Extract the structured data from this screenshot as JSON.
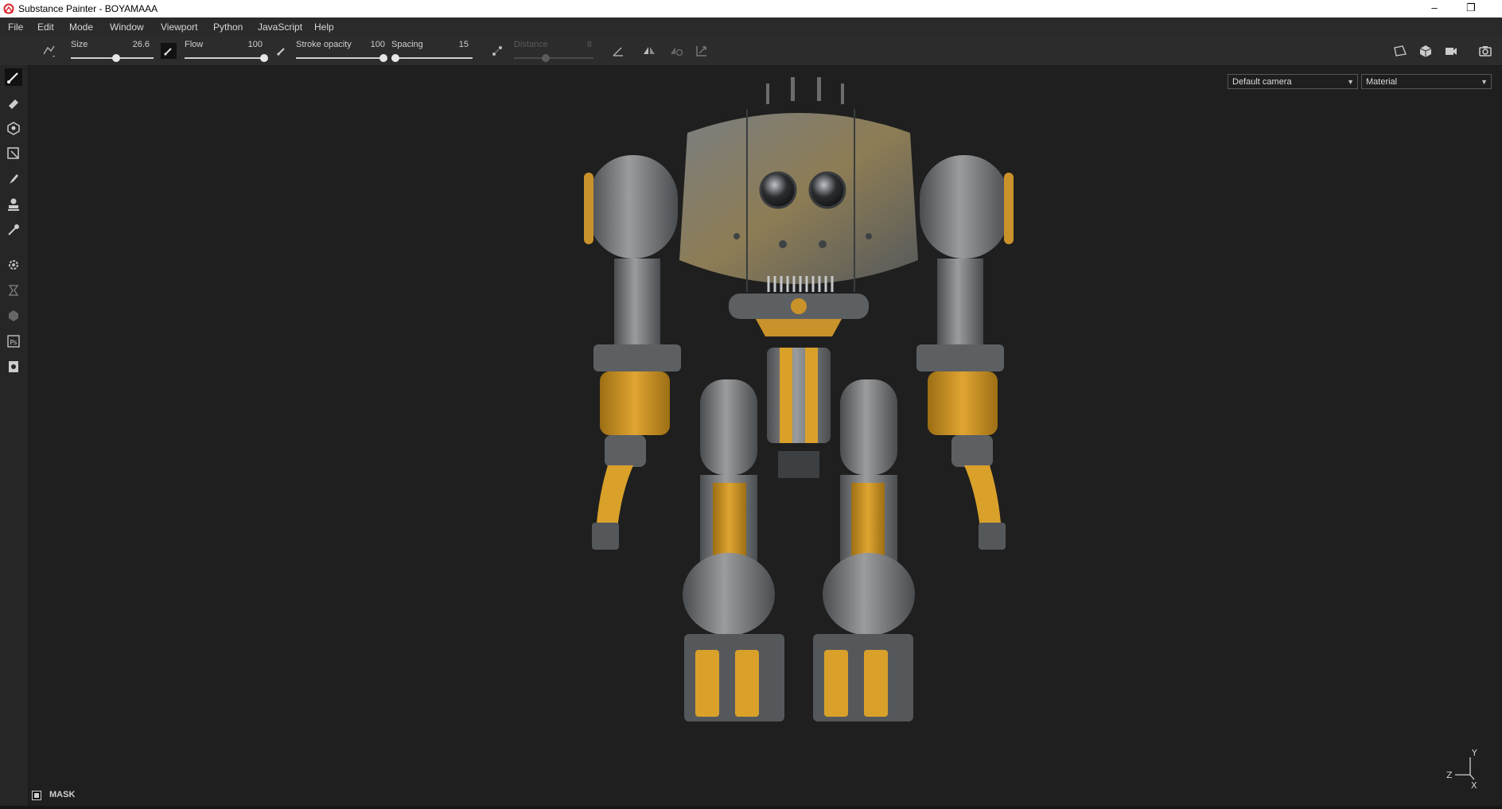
{
  "window": {
    "title": "Substance Painter - BOYAMAAA",
    "minimize_glyph": "–",
    "restore_glyph": "❐"
  },
  "menu": [
    "File",
    "Edit",
    "Mode",
    "Window",
    "Viewport",
    "Python",
    "JavaScript",
    "Help"
  ],
  "toolbar": {
    "size": {
      "label": "Size",
      "value": "26.6",
      "level": 0.55
    },
    "flow": {
      "label": "Flow",
      "value": "100",
      "level": 1.0
    },
    "stroke_opacity": {
      "label": "Stroke opacity",
      "value": "100",
      "level": 1.0
    },
    "spacing": {
      "label": "Spacing",
      "value": "15",
      "level": 0.05
    },
    "distance": {
      "label": "Distance",
      "value": "8",
      "level": 0.4,
      "enabled": false
    }
  },
  "viewport": {
    "camera": "Default camera",
    "display_mode": "Material",
    "mask_label": "MASK",
    "axis": {
      "y": "Y",
      "z": "Z",
      "x": "X"
    }
  },
  "colors": {
    "accent_yellow": "#d9a12a",
    "metal": "#8a8c8e",
    "bg": "#1f1f1f"
  }
}
